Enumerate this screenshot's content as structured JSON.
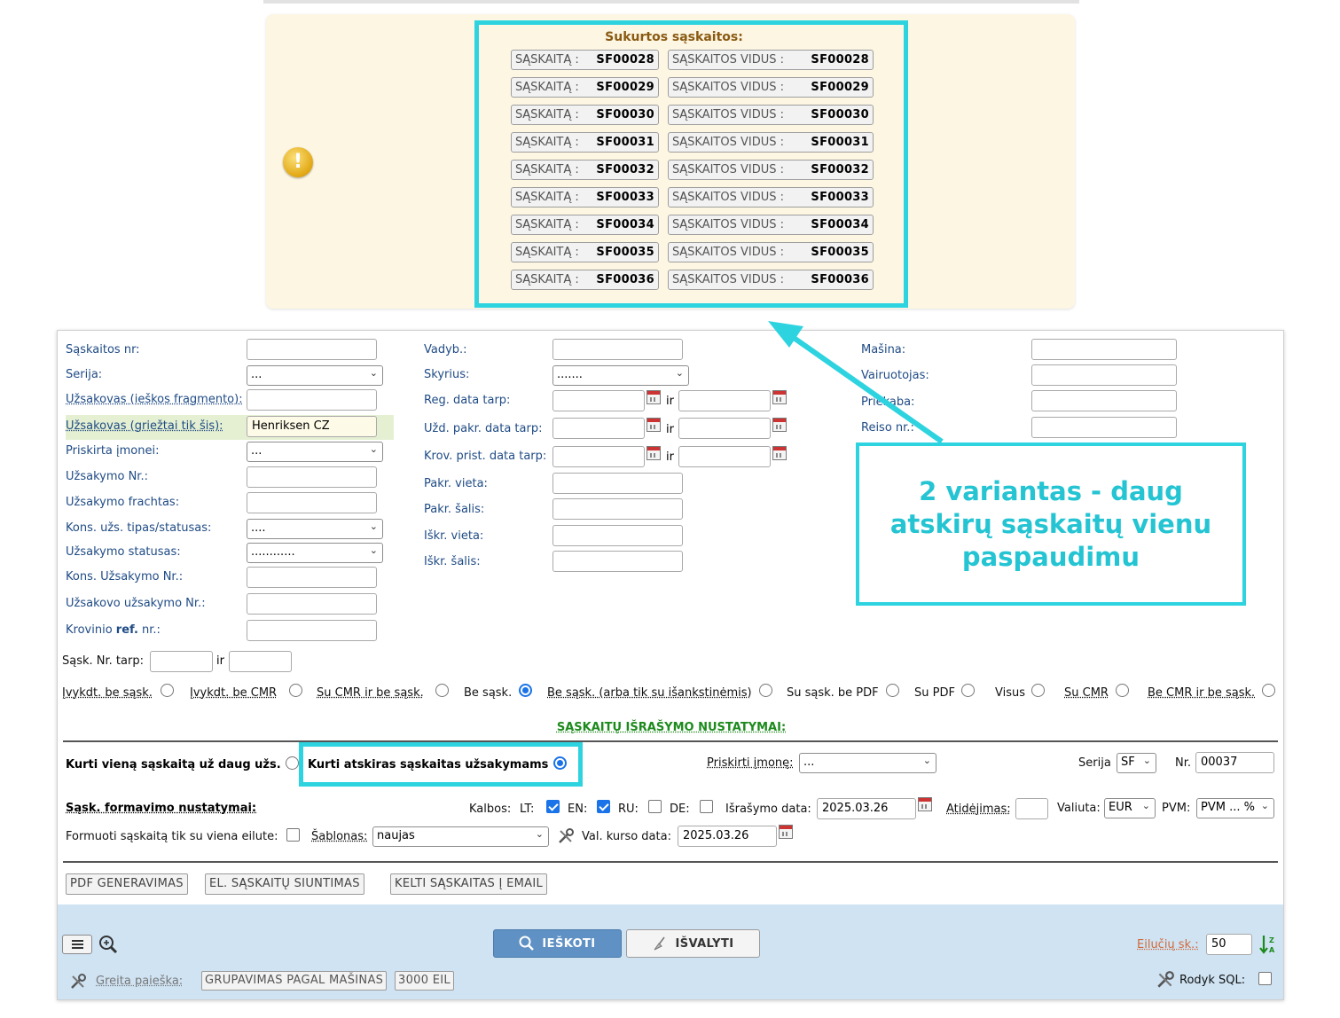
{
  "notice": {
    "title": "Sukurtos sąskaitos:",
    "invoices": [
      {
        "prefix": "SĄSKAITĄ :",
        "id": "SF00028",
        "view_prefix": "SĄSKAITOS VIDUS :"
      },
      {
        "prefix": "SĄSKAITĄ :",
        "id": "SF00029",
        "view_prefix": "SĄSKAITOS VIDUS :"
      },
      {
        "prefix": "SĄSKAITĄ :",
        "id": "SF00030",
        "view_prefix": "SĄSKAITOS VIDUS :"
      },
      {
        "prefix": "SĄSKAITĄ :",
        "id": "SF00031",
        "view_prefix": "SĄSKAITOS VIDUS :"
      },
      {
        "prefix": "SĄSKAITĄ :",
        "id": "SF00032",
        "view_prefix": "SĄSKAITOS VIDUS :"
      },
      {
        "prefix": "SĄSKAITĄ :",
        "id": "SF00033",
        "view_prefix": "SĄSKAITOS VIDUS :"
      },
      {
        "prefix": "SĄSKAITĄ :",
        "id": "SF00034",
        "view_prefix": "SĄSKAITOS VIDUS :"
      },
      {
        "prefix": "SĄSKAITĄ :",
        "id": "SF00035",
        "view_prefix": "SĄSKAITOS VIDUS :"
      },
      {
        "prefix": "SĄSKAITĄ :",
        "id": "SF00036",
        "view_prefix": "SĄSKAITOS VIDUS :"
      }
    ],
    "icon": "warning-icon"
  },
  "filters": {
    "col1": {
      "invoice_nr": "Sąskaitos nr:",
      "series": "Serija:",
      "series_value": "...",
      "customer_fragment": "Užsakovas (ieškos fragmento):",
      "customer_exact": "Užsakovas (griežtai tik šis):",
      "customer_exact_value": "Henriksen CZ",
      "assigned_company": "Priskirta įmonei:",
      "assigned_company_value": "...",
      "order_nr": "Užsakymo Nr.:",
      "order_freight": "Užsakymo frachtas:",
      "cons_type": "Kons. užs. tipas/statusas:",
      "cons_type_value": "....",
      "order_status": "Užsakymo statusas:",
      "order_status_value": "............",
      "cons_order_nr": "Kons. Užsakymo Nr.:",
      "customer_order_nr": "Užsakovo užsakymo Nr.:",
      "cargo_ref_a": "Krovinio ",
      "cargo_ref_b": "ref.",
      "cargo_ref_c": " nr.:"
    },
    "col2": {
      "manager": "Vadyb.:",
      "department": "Skyrius:",
      "department_value": ".......",
      "reg_date": "Reg. data tarp:",
      "load_date": "Užd. pakr. data tarp:",
      "unload_date": "Krov. prist. data tarp:",
      "load_place": "Pakr. vieta:",
      "load_country": "Pakr. šalis:",
      "unload_place": "Iškr. vieta:",
      "unload_country": "Iškr. šalis:",
      "ir": "ir"
    },
    "col3": {
      "vehicle": "Mašina:",
      "driver": "Vairuotojas:",
      "trailer": "Priekaba:",
      "trip_nr": "Reiso nr.:"
    },
    "range_label": "Sąsk. Nr. tarp:",
    "range_ir": "ir"
  },
  "radios": [
    {
      "label": "Įvykdt. be sąsk.",
      "checked": false
    },
    {
      "label": "Įvykdt. be CMR",
      "checked": false
    },
    {
      "label": "Su CMR ir be sąsk.",
      "checked": false
    },
    {
      "label": "Be sąsk.",
      "checked": true
    },
    {
      "label": "Be sąsk. (arba tik su išankstinėmis)",
      "checked": false
    },
    {
      "label": "Su sąsk. be PDF",
      "checked": false
    },
    {
      "label": "Su PDF",
      "checked": false
    },
    {
      "label": "Visus",
      "checked": false
    },
    {
      "label": "Su CMR",
      "checked": false
    },
    {
      "label": "Be CMR ir be sąsk.",
      "checked": false
    }
  ],
  "settings": {
    "section_title": "SĄSKAITŲ IŠRAŠYMO NUSTATYMAI:",
    "one_invoice": "Kurti vieną sąskaitą už daug užs.",
    "separate_invoices": "Kurti atskiras sąskaitas užsakymams",
    "assign_company": "Priskirti įmonę:",
    "assign_company_value": "...",
    "series": "Serija",
    "series_value": "SF",
    "nr": "Nr.",
    "nr_value": "00037",
    "formation": "Sąsk. formavimo nustatymai:",
    "languages": "Kalbos:",
    "lang_lt": "LT:",
    "lang_en": "EN:",
    "lang_ru": "RU:",
    "lang_de": "DE:",
    "issue_date": "Išrašymo data:",
    "issue_date_value": "2025.03.26",
    "deferral": "Atidėjimas:",
    "currency": "Valiuta:",
    "currency_value": "EUR",
    "vat": "PVM:",
    "vat_value": "PVM ... %",
    "single_line": "Formuoti sąskaitą tik su viena eilute:",
    "template": "Šablonas:",
    "template_value": "naujas",
    "rate_date": "Val. kurso data:",
    "rate_date_value": "2025.03.26"
  },
  "actions": {
    "pdf": "PDF GENERAVIMAS",
    "einvoice": "EL. SĄSKAITŲ SIUNTIMAS",
    "email": "KELTI SĄSKAITAS Į EMAIL"
  },
  "bottom": {
    "search": "IEŠKOTI",
    "clear": "IŠVALYTI",
    "rows_label": "Eilučių sk.:",
    "rows_value": "50",
    "quick_search": "Greita paieška:",
    "group_by_vehicle": "GRUPAVIMAS PAGAL MAŠINAS",
    "rows_3000": "3000 EIL",
    "show_sql": "Rodyk SQL:"
  },
  "annotation": {
    "text": "2 variantas - daug atskirų sąskaitų vienu paspaudimu",
    "color": "#2ed3e0"
  }
}
